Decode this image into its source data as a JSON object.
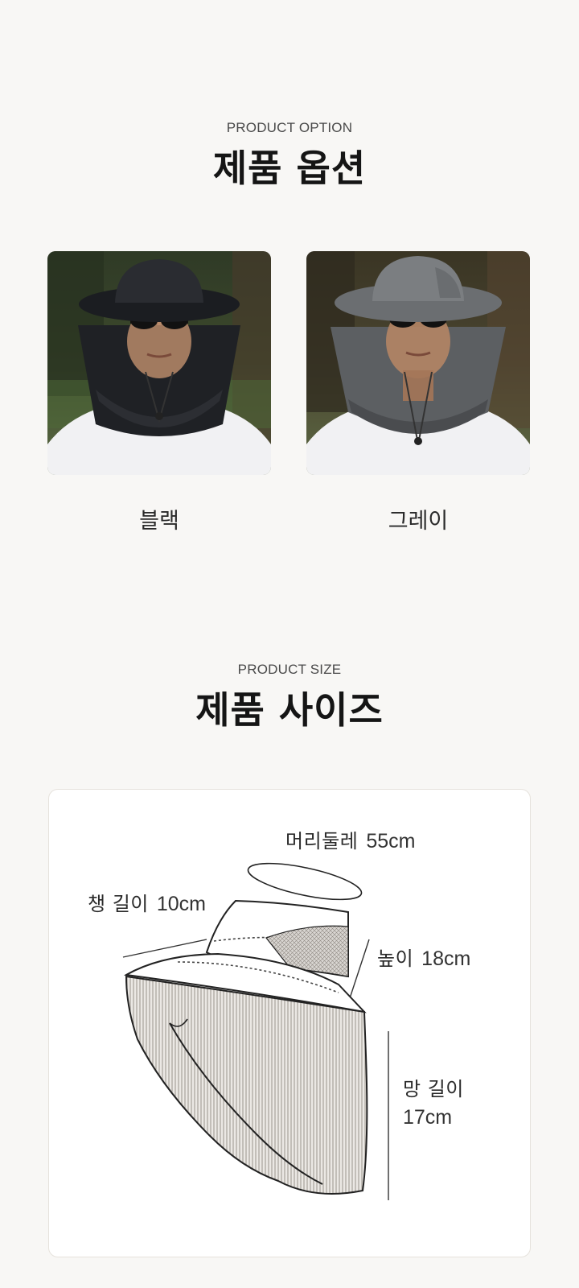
{
  "option_section": {
    "eyebrow": "PRODUCT OPTION",
    "title": "제품 옵션",
    "options": [
      {
        "label": "블랙",
        "color": "#1f2125",
        "icon": "hat-black-photo"
      },
      {
        "label": "그레이",
        "color": "#5c5f62",
        "icon": "hat-gray-photo"
      }
    ]
  },
  "size_section": {
    "eyebrow": "PRODUCT SIZE",
    "title": "제품 사이즈",
    "dimensions": {
      "head": {
        "name": "머리둘레",
        "value": "55cm"
      },
      "brim": {
        "name": "챙 길이",
        "value": "10cm"
      },
      "height": {
        "name": "높이",
        "value": "18cm"
      },
      "mesh": {
        "name": "망 길이",
        "value": "17cm"
      }
    }
  },
  "colors": {
    "background": "#f8f7f5",
    "card": "#ffffff",
    "text": "#151515"
  }
}
